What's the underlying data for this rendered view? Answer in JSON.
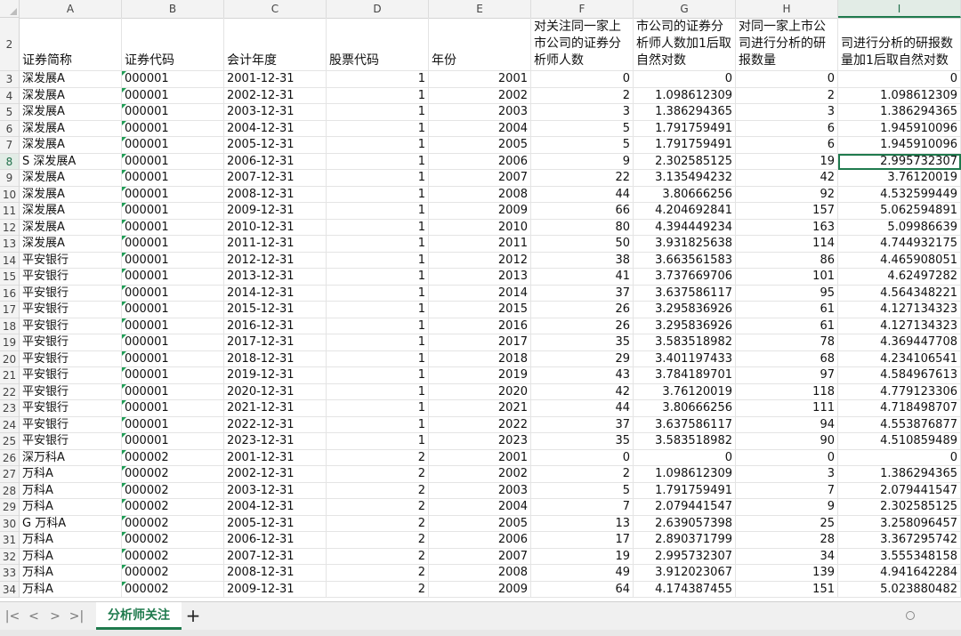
{
  "columns": [
    "A",
    "B",
    "C",
    "D",
    "E",
    "F",
    "G",
    "H",
    "I"
  ],
  "selected_column": "I",
  "active_cell": {
    "row": 8,
    "col": "I"
  },
  "header_row": {
    "row_num": "2",
    "cells": [
      "证券简称",
      "证券代码",
      "会计年度",
      "股票代码",
      "年份",
      "对关注同一家上市公司的证券分析师人数",
      "市公司的证券分析师人数加1后取自然对数",
      "对同一家上市公司进行分析的研报数量",
      "司进行分析的研报数量加1后取自然对数"
    ]
  },
  "rows": [
    {
      "n": "3",
      "c": [
        "深发展A",
        "000001",
        "2001-12-31",
        "1",
        "2001",
        "0",
        "0",
        "0",
        "0"
      ]
    },
    {
      "n": "4",
      "c": [
        "深发展A",
        "000001",
        "2002-12-31",
        "1",
        "2002",
        "2",
        "1.098612309",
        "2",
        "1.098612309"
      ]
    },
    {
      "n": "5",
      "c": [
        "深发展A",
        "000001",
        "2003-12-31",
        "1",
        "2003",
        "3",
        "1.386294365",
        "3",
        "1.386294365"
      ]
    },
    {
      "n": "6",
      "c": [
        "深发展A",
        "000001",
        "2004-12-31",
        "1",
        "2004",
        "5",
        "1.791759491",
        "6",
        "1.945910096"
      ]
    },
    {
      "n": "7",
      "c": [
        "深发展A",
        "000001",
        "2005-12-31",
        "1",
        "2005",
        "5",
        "1.791759491",
        "6",
        "1.945910096"
      ]
    },
    {
      "n": "8",
      "c": [
        "S 深发展A",
        "000001",
        "2006-12-31",
        "1",
        "2006",
        "9",
        "2.302585125",
        "19",
        "2.995732307"
      ]
    },
    {
      "n": "9",
      "c": [
        "深发展A",
        "000001",
        "2007-12-31",
        "1",
        "2007",
        "22",
        "3.135494232",
        "42",
        "3.76120019"
      ]
    },
    {
      "n": "10",
      "c": [
        "深发展A",
        "000001",
        "2008-12-31",
        "1",
        "2008",
        "44",
        "3.80666256",
        "92",
        "4.532599449"
      ]
    },
    {
      "n": "11",
      "c": [
        "深发展A",
        "000001",
        "2009-12-31",
        "1",
        "2009",
        "66",
        "4.204692841",
        "157",
        "5.062594891"
      ]
    },
    {
      "n": "12",
      "c": [
        "深发展A",
        "000001",
        "2010-12-31",
        "1",
        "2010",
        "80",
        "4.394449234",
        "163",
        "5.09986639"
      ]
    },
    {
      "n": "13",
      "c": [
        "深发展A",
        "000001",
        "2011-12-31",
        "1",
        "2011",
        "50",
        "3.931825638",
        "114",
        "4.744932175"
      ]
    },
    {
      "n": "14",
      "c": [
        "平安银行",
        "000001",
        "2012-12-31",
        "1",
        "2012",
        "38",
        "3.663561583",
        "86",
        "4.465908051"
      ]
    },
    {
      "n": "15",
      "c": [
        "平安银行",
        "000001",
        "2013-12-31",
        "1",
        "2013",
        "41",
        "3.737669706",
        "101",
        "4.62497282"
      ]
    },
    {
      "n": "16",
      "c": [
        "平安银行",
        "000001",
        "2014-12-31",
        "1",
        "2014",
        "37",
        "3.637586117",
        "95",
        "4.564348221"
      ]
    },
    {
      "n": "17",
      "c": [
        "平安银行",
        "000001",
        "2015-12-31",
        "1",
        "2015",
        "26",
        "3.295836926",
        "61",
        "4.127134323"
      ]
    },
    {
      "n": "18",
      "c": [
        "平安银行",
        "000001",
        "2016-12-31",
        "1",
        "2016",
        "26",
        "3.295836926",
        "61",
        "4.127134323"
      ]
    },
    {
      "n": "19",
      "c": [
        "平安银行",
        "000001",
        "2017-12-31",
        "1",
        "2017",
        "35",
        "3.583518982",
        "78",
        "4.369447708"
      ]
    },
    {
      "n": "20",
      "c": [
        "平安银行",
        "000001",
        "2018-12-31",
        "1",
        "2018",
        "29",
        "3.401197433",
        "68",
        "4.234106541"
      ]
    },
    {
      "n": "21",
      "c": [
        "平安银行",
        "000001",
        "2019-12-31",
        "1",
        "2019",
        "43",
        "3.784189701",
        "97",
        "4.584967613"
      ]
    },
    {
      "n": "22",
      "c": [
        "平安银行",
        "000001",
        "2020-12-31",
        "1",
        "2020",
        "42",
        "3.76120019",
        "118",
        "4.779123306"
      ]
    },
    {
      "n": "23",
      "c": [
        "平安银行",
        "000001",
        "2021-12-31",
        "1",
        "2021",
        "44",
        "3.80666256",
        "111",
        "4.718498707"
      ]
    },
    {
      "n": "24",
      "c": [
        "平安银行",
        "000001",
        "2022-12-31",
        "1",
        "2022",
        "37",
        "3.637586117",
        "94",
        "4.553876877"
      ]
    },
    {
      "n": "25",
      "c": [
        "平安银行",
        "000001",
        "2023-12-31",
        "1",
        "2023",
        "35",
        "3.583518982",
        "90",
        "4.510859489"
      ]
    },
    {
      "n": "26",
      "c": [
        "深万科A",
        "000002",
        "2001-12-31",
        "2",
        "2001",
        "0",
        "0",
        "0",
        "0"
      ]
    },
    {
      "n": "27",
      "c": [
        "万科A",
        "000002",
        "2002-12-31",
        "2",
        "2002",
        "2",
        "1.098612309",
        "3",
        "1.386294365"
      ]
    },
    {
      "n": "28",
      "c": [
        "万科A",
        "000002",
        "2003-12-31",
        "2",
        "2003",
        "5",
        "1.791759491",
        "7",
        "2.079441547"
      ]
    },
    {
      "n": "29",
      "c": [
        "万科A",
        "000002",
        "2004-12-31",
        "2",
        "2004",
        "7",
        "2.079441547",
        "9",
        "2.302585125"
      ]
    },
    {
      "n": "30",
      "c": [
        "G 万科A",
        "000002",
        "2005-12-31",
        "2",
        "2005",
        "13",
        "2.639057398",
        "25",
        "3.258096457"
      ]
    },
    {
      "n": "31",
      "c": [
        "万科A",
        "000002",
        "2006-12-31",
        "2",
        "2006",
        "17",
        "2.890371799",
        "28",
        "3.367295742"
      ]
    },
    {
      "n": "32",
      "c": [
        "万科A",
        "000002",
        "2007-12-31",
        "2",
        "2007",
        "19",
        "2.995732307",
        "34",
        "3.555348158"
      ]
    },
    {
      "n": "33",
      "c": [
        "万科A",
        "000002",
        "2008-12-31",
        "2",
        "2008",
        "49",
        "3.912023067",
        "139",
        "4.941642284"
      ]
    },
    {
      "n": "34",
      "c": [
        "万科A",
        "000002",
        "2009-12-31",
        "2",
        "2009",
        "64",
        "4.174387455",
        "151",
        "5.023880482"
      ]
    }
  ],
  "tabs": {
    "nav": [
      "|<",
      "<",
      ">",
      ">|"
    ],
    "sheet_name": "分析师关注",
    "add": "+"
  },
  "colors": {
    "accent": "#1f7a4d",
    "header_bg": "#f3f3f3"
  }
}
